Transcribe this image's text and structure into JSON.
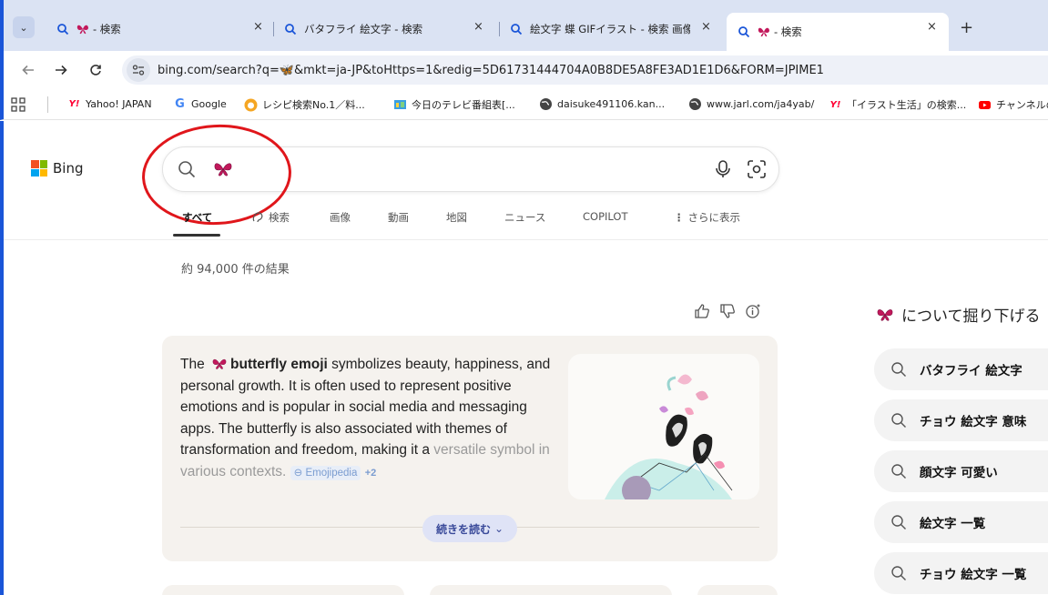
{
  "tabs": [
    {
      "title": "- 検索",
      "active": false
    },
    {
      "title": "バタフライ 絵文字 - 検索",
      "active": false
    },
    {
      "title": "絵文字 蝶 GIFイラスト - 検索 画像",
      "active": false
    },
    {
      "title": "- 検索",
      "active": true
    }
  ],
  "tab_close": "×",
  "new_tab": "+",
  "address": {
    "url": "bing.com/search?q=🦋&mkt=ja-JP&toHttps=1&redig=5D61731444704A0B8DE5A8FE3AD1E1D6&FORM=JPIME1"
  },
  "bookmarks": [
    {
      "label": "Yahoo! JAPAN",
      "icon": "Y!"
    },
    {
      "label": "Google",
      "icon": "G"
    },
    {
      "label": "レシピ検索No.1／料...",
      "icon": "chef-icon"
    },
    {
      "label": "今日のテレビ番組表[...",
      "icon": "tv-icon"
    },
    {
      "label": "daisuke491106.kan...",
      "icon": "globe-icon"
    },
    {
      "label": "www.jarl.com/ja4yab/",
      "icon": "globe-icon"
    },
    {
      "label": "「イラスト生活」の検索...",
      "icon": "Y!"
    },
    {
      "label": "チャンネルの",
      "icon": "youtube-icon"
    }
  ],
  "brand": {
    "name": "Bing"
  },
  "nav_tabs": [
    "すべて",
    "検索",
    "画像",
    "動画",
    "地図",
    "ニュース",
    "COPILOT",
    "さらに表示"
  ],
  "result_count": "約 94,000 件の結果",
  "answer": {
    "t1": "The ",
    "t2": "butterfly emoji",
    "t3": " symbolizes beauty, happiness, and personal growth. It is often used to represent positive emotions and is popular in social media and messaging apps. The butterfly is also associated with themes of transformation and freedom, making it a ",
    "t4": "versatile symbol in various contexts.",
    "cite": "Emojipedia",
    "cite_more": "+2",
    "read_more": "続きを読む"
  },
  "related": {
    "title": "について掘り下げる",
    "items": [
      "バタフライ 絵文字",
      "チョウ 絵文字 意味",
      "顔文字 可愛い",
      "絵文字 一覧",
      "チョウ 絵文字 一覧"
    ]
  },
  "colors": {
    "accent": "#1a55d8",
    "annotation": "#e0161b",
    "card": "#f5f2ee"
  }
}
